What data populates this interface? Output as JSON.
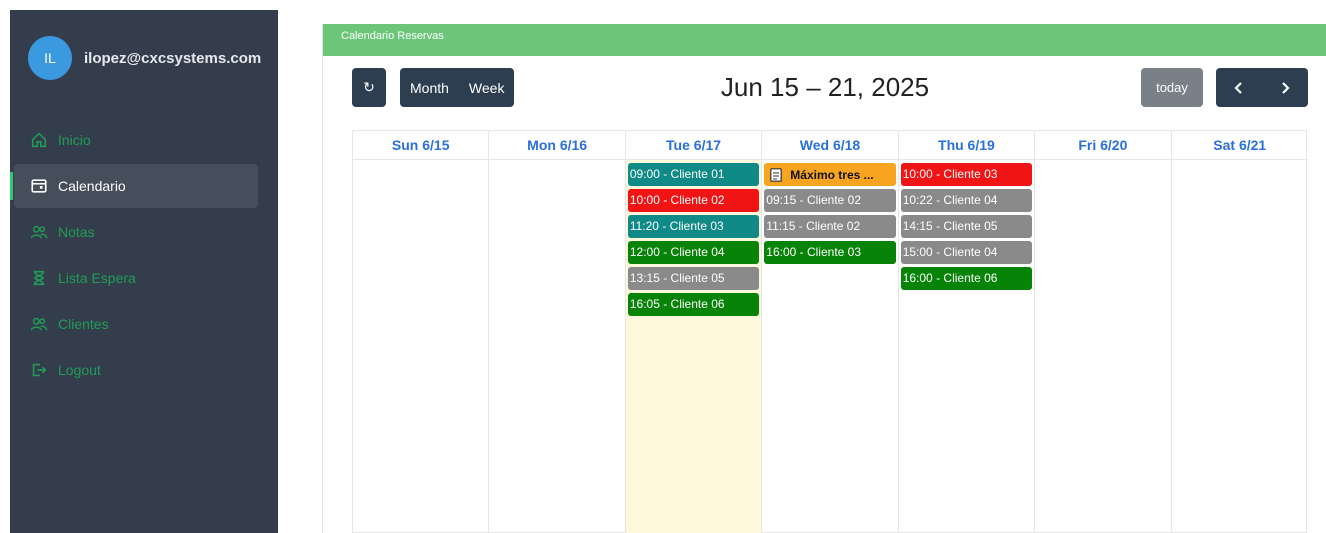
{
  "sidebar": {
    "user": {
      "initials": "IL",
      "email": "ilopez@cxcsystems.com"
    },
    "items": [
      {
        "label": "Inicio",
        "icon": "home-icon",
        "active": false
      },
      {
        "label": "Calendario",
        "icon": "calendar-icon",
        "active": true
      },
      {
        "label": "Notas",
        "icon": "users-icon",
        "active": false
      },
      {
        "label": "Lista Espera",
        "icon": "hourglass-icon",
        "active": false
      },
      {
        "label": "Clientes",
        "icon": "users-icon",
        "active": false
      },
      {
        "label": "Logout",
        "icon": "logout-icon",
        "active": false
      }
    ]
  },
  "card": {
    "header": "Calendario Reservas"
  },
  "toolbar": {
    "refresh": "↻",
    "month": "Month",
    "week": "Week",
    "title": "Jun 15 – 21, 2025",
    "today": "today"
  },
  "colors": {
    "teal": "#0f8a87",
    "red": "#f01414",
    "green": "#078407",
    "gray": "#8a8a8a",
    "orange": "#f7a521"
  },
  "calendar": {
    "days": [
      {
        "label": "Sun 6/15",
        "today": false,
        "events": []
      },
      {
        "label": "Mon 6/16",
        "today": false,
        "events": []
      },
      {
        "label": "Tue 6/17",
        "today": true,
        "events": [
          {
            "text": "09:00 - Cliente 01",
            "color": "#0f8a87"
          },
          {
            "text": "10:00 - Cliente 02",
            "color": "#f01414"
          },
          {
            "text": "11:20 - Cliente 03",
            "color": "#0f8a87"
          },
          {
            "text": "12:00 - Cliente 04",
            "color": "#078407"
          },
          {
            "text": "13:15 - Cliente 05",
            "color": "#8a8a8a"
          },
          {
            "text": "16:05 - Cliente 06",
            "color": "#078407"
          }
        ]
      },
      {
        "label": "Wed 6/18",
        "today": false,
        "events": [
          {
            "text": "Máximo tres ...",
            "color": "#f7a521",
            "note": true
          },
          {
            "text": "09:15 - Cliente 02",
            "color": "#8a8a8a"
          },
          {
            "text": "11:15 - Cliente 02",
            "color": "#8a8a8a"
          },
          {
            "text": "16:00 - Cliente 03",
            "color": "#078407"
          }
        ]
      },
      {
        "label": "Thu 6/19",
        "today": false,
        "events": [
          {
            "text": "10:00 - Cliente 03",
            "color": "#f01414"
          },
          {
            "text": "10:22 - Cliente 04",
            "color": "#8a8a8a"
          },
          {
            "text": "14:15 - Cliente 05",
            "color": "#8a8a8a"
          },
          {
            "text": "15:00 - Cliente 04",
            "color": "#8a8a8a"
          },
          {
            "text": "16:00 - Cliente 06",
            "color": "#078407"
          }
        ]
      },
      {
        "label": "Fri 6/20",
        "today": false,
        "events": []
      },
      {
        "label": "Sat 6/21",
        "today": false,
        "events": []
      }
    ]
  }
}
